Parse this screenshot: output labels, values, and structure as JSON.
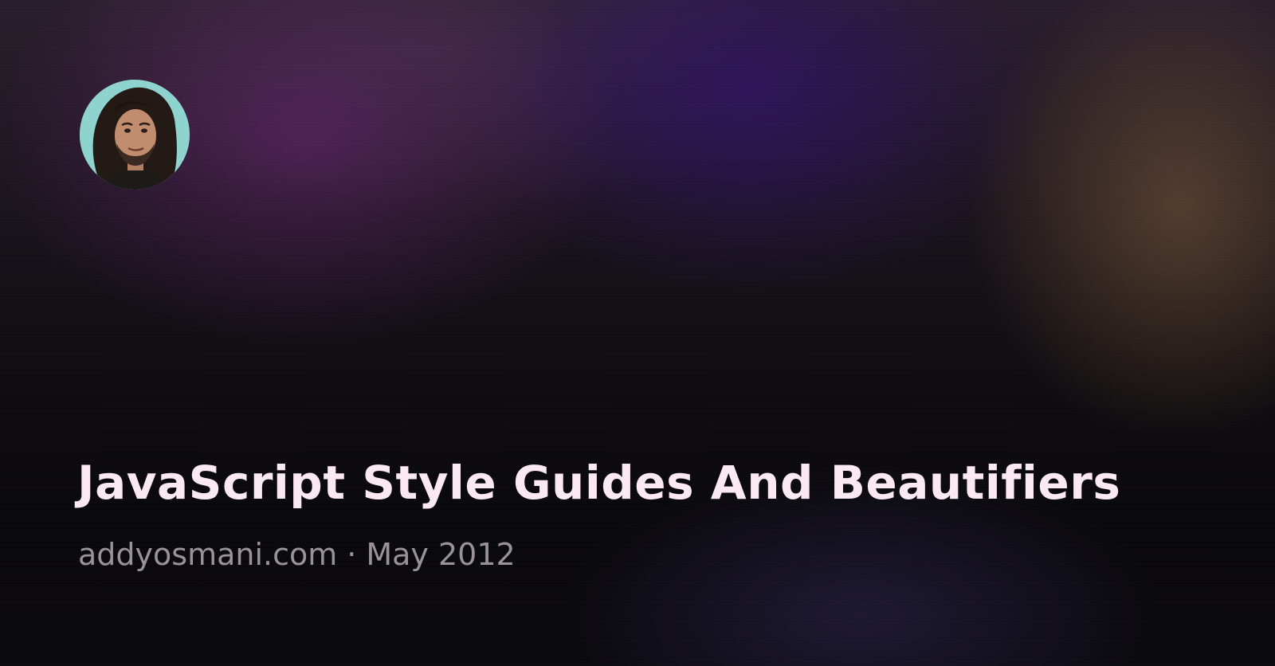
{
  "post": {
    "title": "JavaScript Style Guides And Beautifiers",
    "site": "addyosmani.com",
    "separator": "·",
    "date": "May 2012"
  },
  "colors": {
    "title_text": "#fbe9f1",
    "meta_text": "#9a9298",
    "avatar_background": "#8fd3cf"
  }
}
